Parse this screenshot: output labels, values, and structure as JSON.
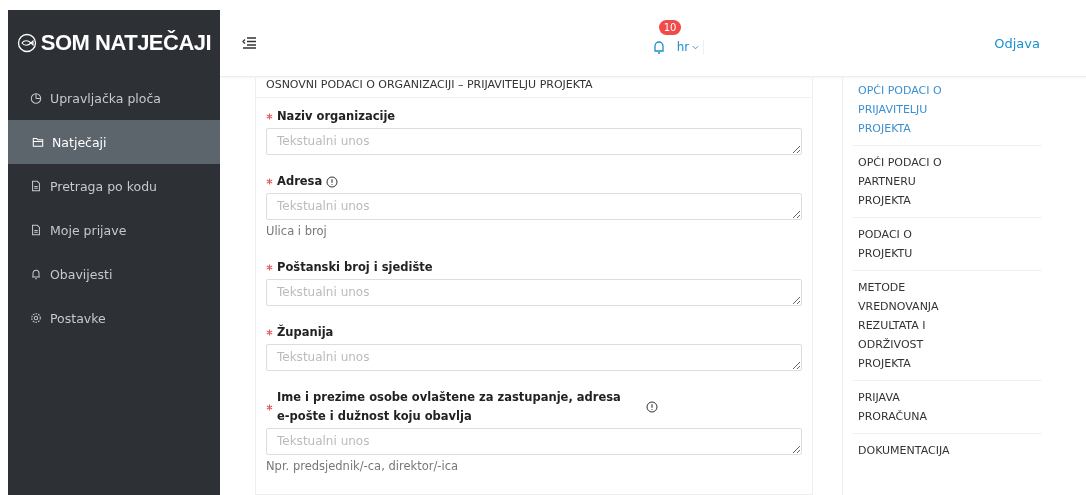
{
  "brand": {
    "logo": "SOM NATJEČAJI"
  },
  "sidebar": {
    "items": [
      {
        "label": "Upravljačka ploča",
        "kind": "chart",
        "selected": false
      },
      {
        "label": "Natječaji",
        "kind": "folder",
        "selected": true
      },
      {
        "label": "Pretraga po kodu",
        "kind": "doc",
        "selected": false
      },
      {
        "label": "Moje prijave",
        "kind": "doc",
        "selected": false
      },
      {
        "label": "Obavijesti",
        "kind": "bell",
        "selected": false
      },
      {
        "label": "Postavke",
        "kind": "gear",
        "selected": false
      }
    ]
  },
  "header": {
    "notifications": "10",
    "language": "hr",
    "logout": "Odjava"
  },
  "form": {
    "title": "OSNOVNI PODACI O ORGANIZACIJI – PRIJAVITELJU PROJEKTA",
    "fields": [
      {
        "label": "Naziv organizacije",
        "required": true,
        "info": false,
        "placeholder": "Tekstualni unos"
      },
      {
        "label": "Adresa",
        "required": true,
        "info": true,
        "placeholder": "Tekstualni unos",
        "hint": "Ulica i broj"
      },
      {
        "label": "Poštanski broj i sjedište",
        "required": true,
        "info": false,
        "placeholder": "Tekstualni unos"
      },
      {
        "label": "Županija",
        "required": true,
        "info": false,
        "placeholder": "Tekstualni unos"
      },
      {
        "label": "Ime i prezime osobe ovlaštene za zastupanje, adresa e-pošte i dužnost koju obavlja",
        "required": true,
        "info": true,
        "placeholder": "Tekstualni unos",
        "hint": "Npr. predsjednik/-ca, direktor/-ica"
      }
    ]
  },
  "section_nav": {
    "items": [
      {
        "label": "OPĆI PODACI O PRIJAVITELJU PROJEKTA",
        "selected": true
      },
      {
        "label": "OPĆI PODACI O PARTNERU PROJEKTA",
        "selected": false
      },
      {
        "label": "PODACI O PROJEKTU",
        "selected": false
      },
      {
        "label": "METODE VREDNOVANJA REZULTATA I ODRŽIVOST PROJEKTA",
        "selected": false
      },
      {
        "label": "PRIJAVA PRORAČUNA",
        "selected": false
      },
      {
        "label": "DOKUMENTACIJA",
        "selected": false
      }
    ]
  }
}
